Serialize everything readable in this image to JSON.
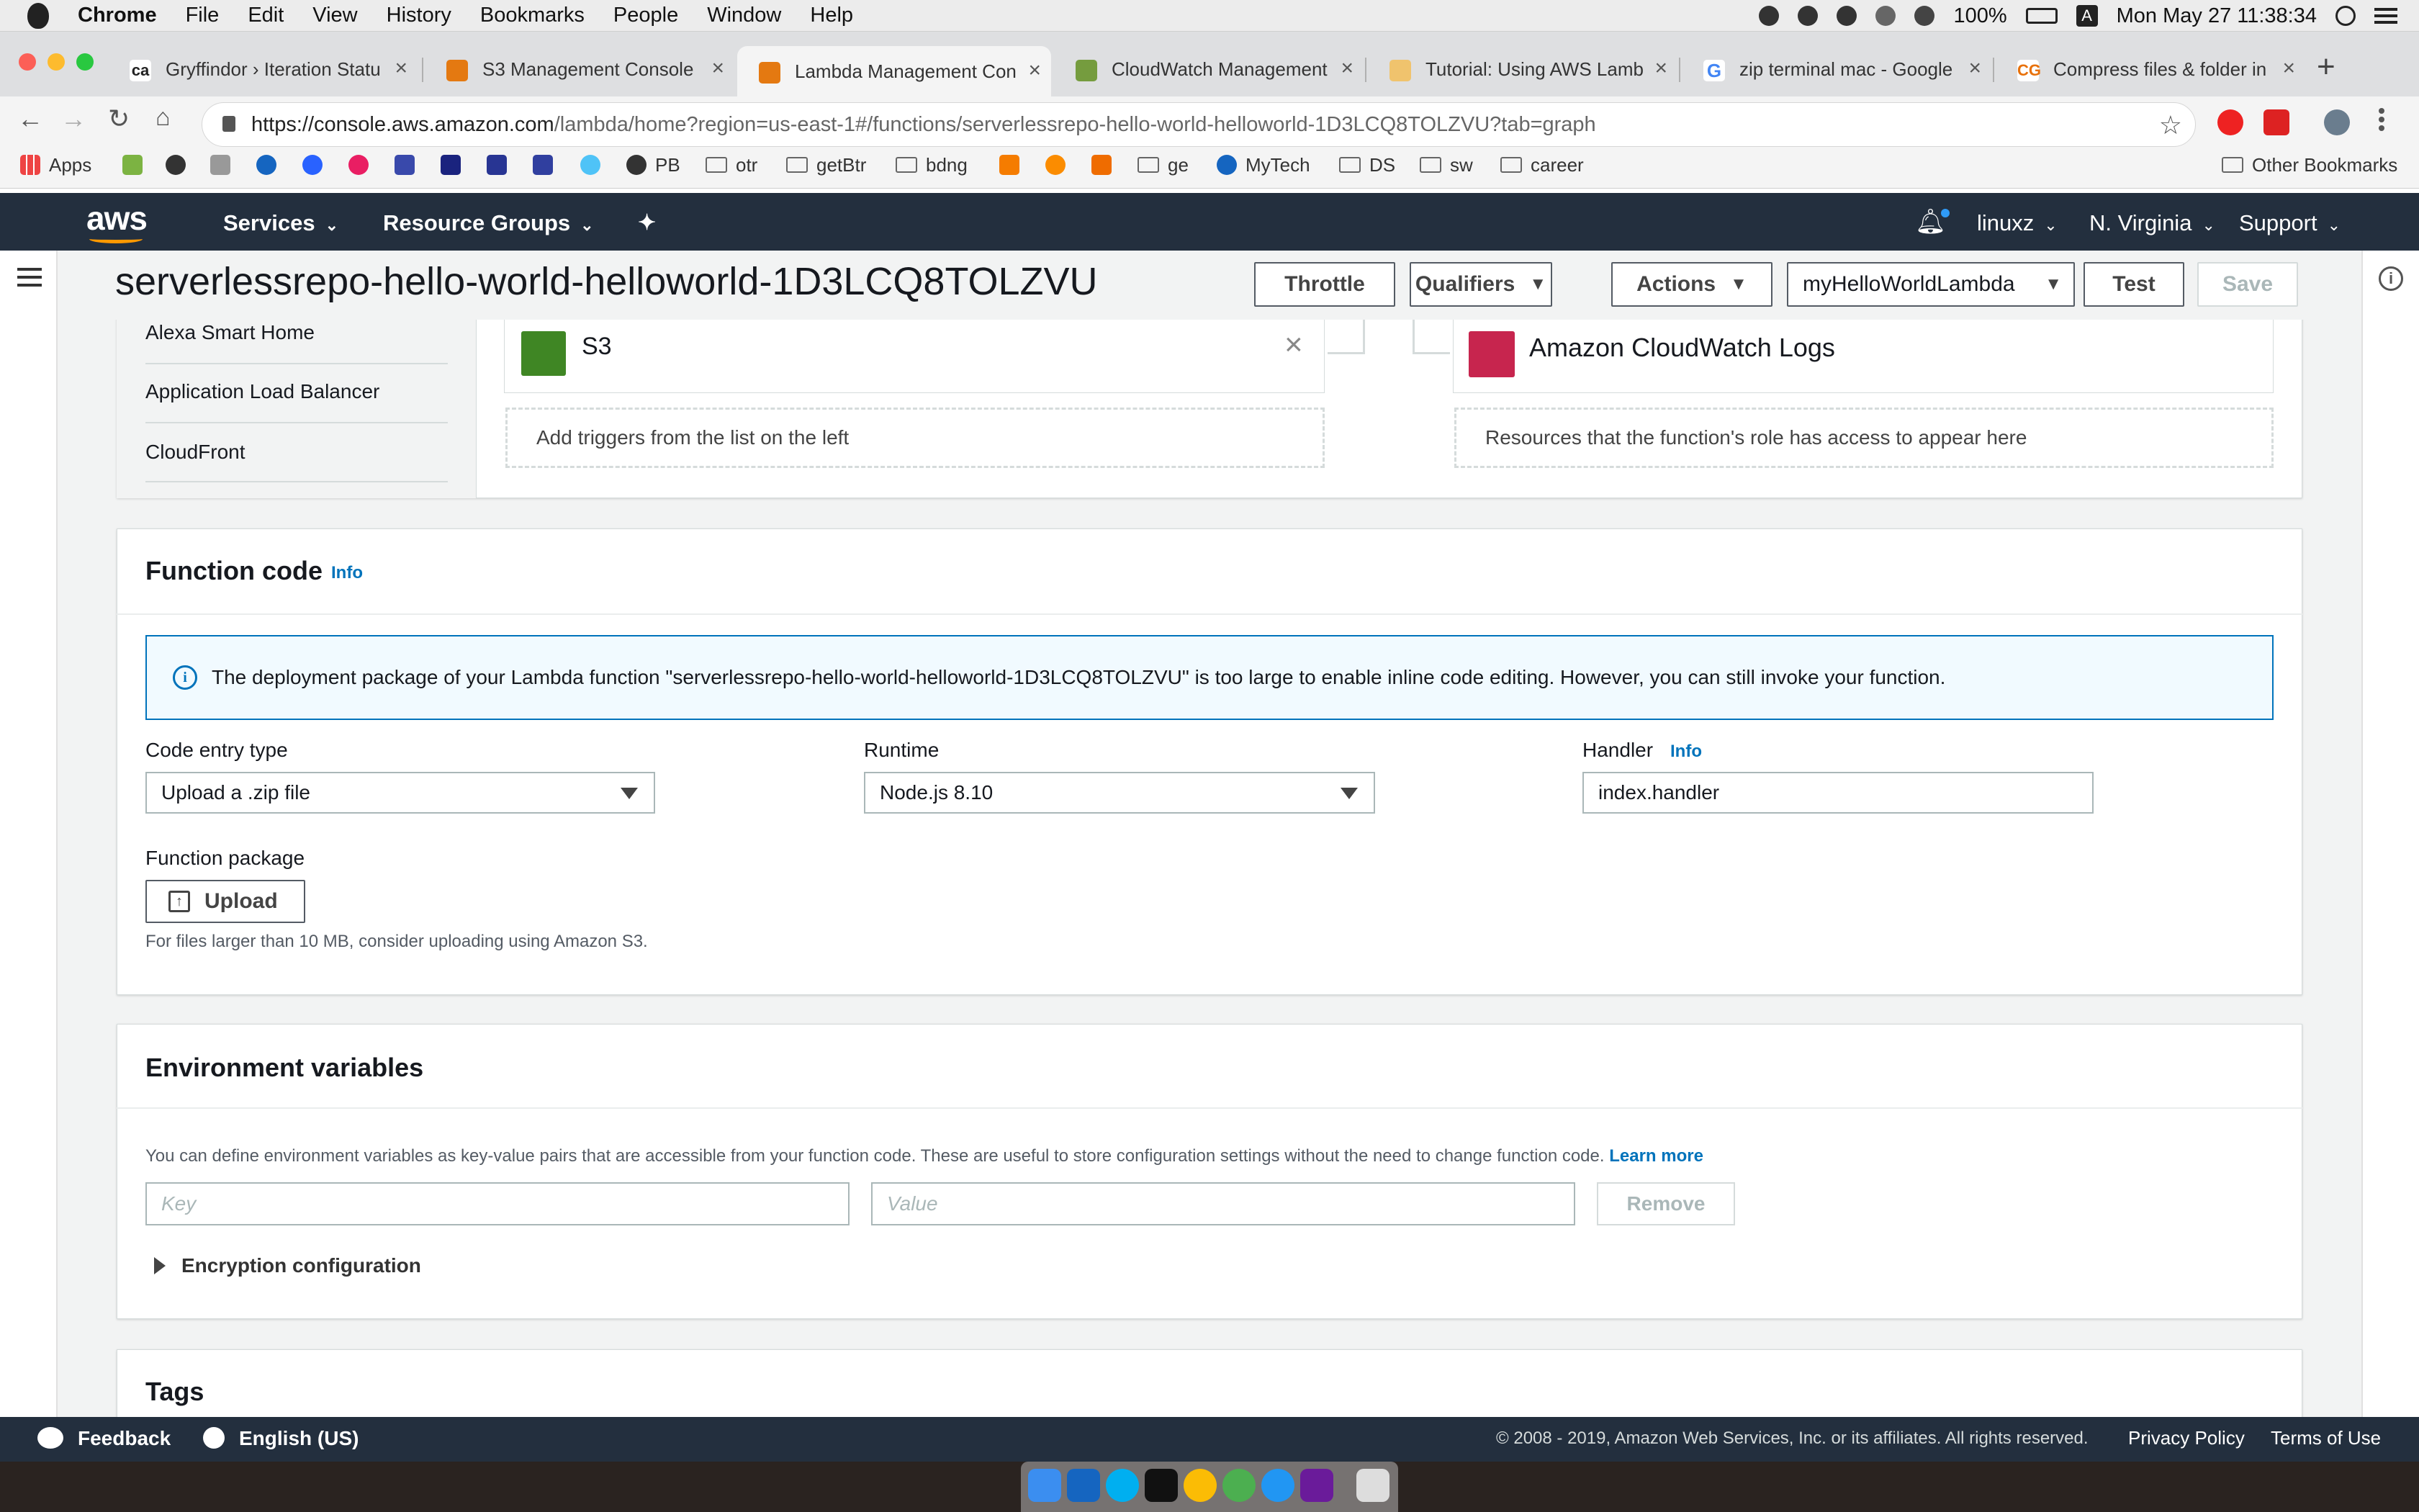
{
  "menubar": {
    "app": "Chrome",
    "items": [
      "File",
      "Edit",
      "View",
      "History",
      "Bookmarks",
      "People",
      "Window",
      "Help"
    ],
    "battery": "100%",
    "clock": "Mon May 27  11:38:34"
  },
  "tabs": [
    {
      "title": "Gryffindor › Iteration Statu"
    },
    {
      "title": "S3 Management Console"
    },
    {
      "title": "Lambda Management Con"
    },
    {
      "title": "CloudWatch Management"
    },
    {
      "title": "Tutorial: Using AWS Lamb"
    },
    {
      "title": "zip terminal mac - Google"
    },
    {
      "title": "Compress files & folder in"
    }
  ],
  "address": {
    "host": "https://console.aws.amazon.com",
    "path": "/lambda/home?region=us-east-1#/functions/serverlessrepo-hello-world-helloworld-1D3LCQ8TOLZVU?tab=graph"
  },
  "bookmarks": [
    "Apps",
    "PB",
    "otr",
    "getBtr",
    "bdng",
    "ge",
    "MyTech",
    "DS",
    "sw",
    "career",
    "Other Bookmarks"
  ],
  "aws": {
    "logo": "aws",
    "services": "Services",
    "resource_groups": "Resource Groups",
    "user": "linuxz",
    "region": "N. Virginia",
    "support": "Support"
  },
  "function": {
    "name": "serverlessrepo-hello-world-helloworld-1D3LCQ8TOLZVU",
    "throttle": "Throttle",
    "qualifiers": "Qualifiers",
    "actions": "Actions",
    "test_event": "myHelloWorldLambda",
    "test": "Test",
    "save": "Save"
  },
  "designer": {
    "triggers": [
      "Alexa Smart Home",
      "Application Load Balancer",
      "CloudFront"
    ],
    "s3": "S3",
    "add_triggers": "Add triggers from the list on the left",
    "cw_logs": "Amazon CloudWatch Logs",
    "resources_note": "Resources that the function's role has access to appear here"
  },
  "function_code": {
    "title": "Function code",
    "info": "Info",
    "alert": "The deployment package of your Lambda function \"serverlessrepo-hello-world-helloworld-1D3LCQ8TOLZVU\" is too large to enable inline code editing. However, you can still invoke your function.",
    "code_entry_label": "Code entry type",
    "code_entry_value": "Upload a .zip file",
    "runtime_label": "Runtime",
    "runtime_value": "Node.js 8.10",
    "handler_label": "Handler",
    "handler_info": "Info",
    "handler_value": "index.handler",
    "package_label": "Function package",
    "upload": "Upload",
    "upload_hint": "For files larger than 10 MB, consider uploading using Amazon S3."
  },
  "env": {
    "title": "Environment variables",
    "description": "You can define environment variables as key-value pairs that are accessible from your function code. These are useful to store configuration settings without the need to change function code.",
    "learn_more": "Learn more",
    "key_placeholder": "Key",
    "value_placeholder": "Value",
    "remove": "Remove",
    "encryption": "Encryption configuration"
  },
  "tags": {
    "title": "Tags"
  },
  "footer": {
    "feedback": "Feedback",
    "language": "English (US)",
    "copyright": "© 2008 - 2019, Amazon Web Services, Inc. or its affiliates. All rights reserved.",
    "privacy": "Privacy Policy",
    "terms": "Terms of Use"
  }
}
